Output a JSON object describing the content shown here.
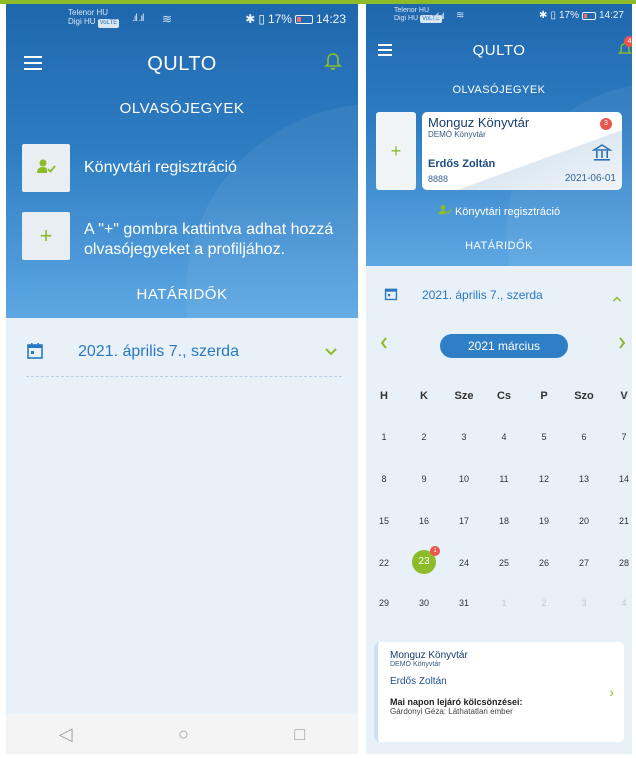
{
  "left": {
    "status": {
      "carrier1": "Telenor HU",
      "carrier2": "Digi HU",
      "volte": "VoLTE",
      "signal": ".ıl .ıl",
      "wifi": "≋",
      "bt": "✱",
      "vibrate": "▯",
      "battery_pct": "17%",
      "time": "14:23"
    },
    "appbar": {
      "title": "QULTO"
    },
    "cards_section": "OLVASÓJEGYEK",
    "registration_label": "Könyvtári regisztráció",
    "add_hint": "A \"+\" gombra kattintva adhat hozzá olvasójegyeket a profiljához.",
    "deadlines_section": "HATÁRIDŐK",
    "date_label": "2021. április 7., szerda",
    "nav": {
      "back": "◁",
      "home": "○",
      "recent": "□"
    }
  },
  "right": {
    "status": {
      "carrier1": "Telenor HU",
      "carrier2": "Digi HU",
      "volte": "VoLTE",
      "signal": ".ıl .ıl",
      "wifi": "≋",
      "bt": "✱",
      "vibrate": "▯",
      "battery_pct": "17%",
      "time": "14:27"
    },
    "appbar": {
      "title": "QULTO",
      "bell_badge": "4"
    },
    "cards_section": "OLVASÓJEGYEK",
    "card": {
      "library": "Monguz Könyvtár",
      "sublibrary": "DEMÓ Könyvtár",
      "badge": "3",
      "name": "Erdős Zoltán",
      "number": "8888",
      "date": "2021-06-01"
    },
    "registration_label": "Könyvtári regisztráció",
    "deadlines_section": "HATÁRIDŐK",
    "date_label": "2021. április 7., szerda",
    "calendar": {
      "month": "2021 március",
      "weekdays": [
        "H",
        "K",
        "Sze",
        "Cs",
        "P",
        "Szo",
        "V"
      ],
      "weeks": [
        [
          "1",
          "2",
          "3",
          "4",
          "5",
          "6",
          "7"
        ],
        [
          "8",
          "9",
          "10",
          "11",
          "12",
          "13",
          "14"
        ],
        [
          "15",
          "16",
          "17",
          "18",
          "19",
          "20",
          "21"
        ],
        [
          "22",
          "23",
          "24",
          "25",
          "26",
          "27",
          "28"
        ],
        [
          "29",
          "30",
          "31",
          "1",
          "2",
          "3",
          "4"
        ]
      ],
      "selected_day": "23",
      "selected_badge": "1"
    },
    "loan": {
      "library": "Monguz Könyvtár",
      "sublibrary": "DEMÓ Könyvtár",
      "user": "Erdős Zoltán",
      "due_title": "Mai napon lejáró kölcsönzései:",
      "book": "Gárdonyi Géza: Láthatatlan ember"
    }
  },
  "colors": {
    "header_blue": "#1f67ad",
    "accent_green": "#8dbb2a",
    "link_blue": "#2a78c0",
    "badge_red": "#e8564c"
  }
}
